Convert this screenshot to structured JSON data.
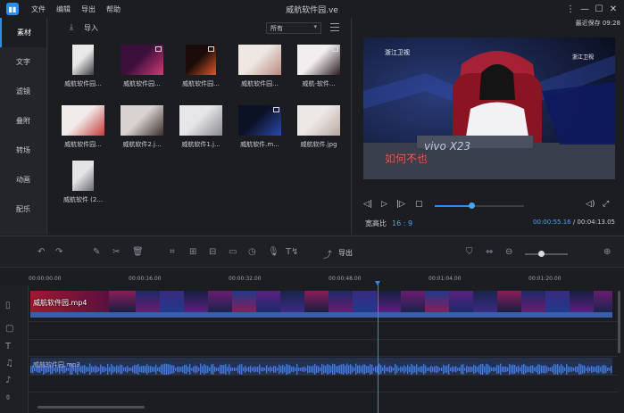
{
  "app": {
    "title": "威航软件园.ve",
    "menu": [
      "文件",
      "编辑",
      "导出",
      "帮助"
    ],
    "logo_glyph": "▮▮"
  },
  "window_controls": [
    "⋮",
    "—",
    "☐",
    "✕"
  ],
  "left_tabs": [
    "素材",
    "文字",
    "滤镜",
    "叠附",
    "转场",
    "动画",
    "配乐"
  ],
  "media": {
    "import_label": "导入",
    "filter_value": "所有",
    "items": [
      {
        "name": "威航软件园...",
        "badge": false,
        "colors": [
          "#e9e9ea",
          "#3b3b3f"
        ]
      },
      {
        "name": "威航软件园...",
        "badge": true,
        "colors": [
          "#3a0f3a",
          "#d23a78"
        ]
      },
      {
        "name": "威航软件园...",
        "badge": true,
        "colors": [
          "#1a0c08",
          "#e0582a"
        ]
      },
      {
        "name": "威航软件园...",
        "badge": false,
        "colors": [
          "#efe7e2",
          "#b88c80"
        ]
      },
      {
        "name": "威航-软件...",
        "badge": true,
        "colors": [
          "#f2eef0",
          "#2a1c22"
        ]
      },
      {
        "name": "威航软件园...",
        "badge": false,
        "colors": [
          "#f1ecea",
          "#c23a3a"
        ]
      },
      {
        "name": "威航软件2.j...",
        "badge": false,
        "colors": [
          "#d8d2d0",
          "#3a2e2c"
        ]
      },
      {
        "name": "威航软件1.j...",
        "badge": false,
        "colors": [
          "#e6e6e8",
          "#8a8a90"
        ]
      },
      {
        "name": "威航软件.m...",
        "badge": true,
        "colors": [
          "#0c1226",
          "#2a4ab0"
        ]
      },
      {
        "name": "威航软件.jpg",
        "badge": false,
        "colors": [
          "#ece8e6",
          "#b8a8a0"
        ]
      },
      {
        "name": "威航软件 (2...",
        "badge": false,
        "colors": [
          "#e4e4e6",
          "#6a6a70"
        ]
      }
    ]
  },
  "preview": {
    "autosave": "最近保存 09:28",
    "aspect_label": "宽高比",
    "aspect_value": "16 : 9",
    "current_time": "00:00:55.16",
    "total_time": "00:04:13.05",
    "progress": 0.41,
    "channel_logo": "浙江卫视",
    "channel_logo_right": "浙江卫视",
    "vivo": "vivo X23",
    "caption": "如何不也"
  },
  "toolbar": {
    "export_label": "导出",
    "zoom_level": 0.38
  },
  "timeline": {
    "ticks": [
      "00:00:00.00",
      "00:00:16.00",
      "00:00:32.00",
      "00:00:48.00",
      "00:01:04.00",
      "00:01:20.00"
    ],
    "video_clip": "威航软件园.mp4",
    "audio_clip": "威航软件园.mp3",
    "playhead_time": "00:00:55.16"
  }
}
